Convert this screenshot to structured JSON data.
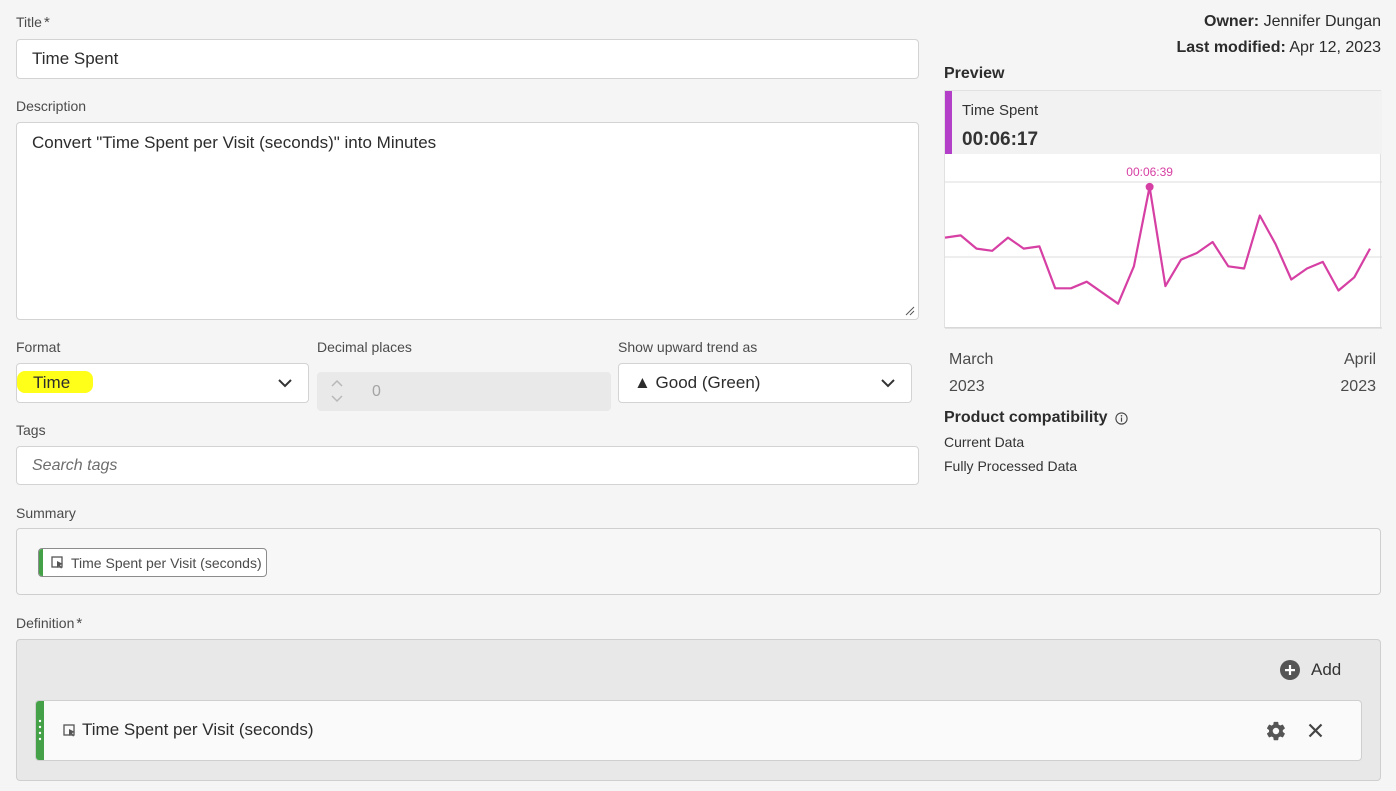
{
  "form": {
    "title_label": "Title",
    "required_mark": "*",
    "title_value": "Time Spent",
    "description_label": "Description",
    "description_value": "Convert \"Time Spent per Visit (seconds)\" into Minutes",
    "format_label": "Format",
    "format_value": "Time",
    "decimal_label": "Decimal places",
    "decimal_value": "0",
    "trend_label": "Show upward trend as",
    "trend_value": "▲ Good (Green)",
    "tags_label": "Tags",
    "tags_placeholder": "Search tags",
    "summary_label": "Summary",
    "summary_chip": "Time Spent per Visit (seconds)",
    "definition_label": "Definition",
    "add_label": "Add",
    "definition_item": "Time Spent per Visit (seconds)"
  },
  "meta": {
    "owner_label": "Owner:",
    "owner_value": "Jennifer Dungan",
    "modified_label": "Last modified:",
    "modified_value": "Apr 12, 2023"
  },
  "preview": {
    "label": "Preview",
    "metric_name": "Time Spent",
    "metric_value": "00:06:17",
    "peak_label": "00:06:39",
    "x_start_month": "March",
    "x_start_year": "2023",
    "x_end_month": "April",
    "x_end_year": "2023",
    "line_color": "#d63fa3",
    "accent_color": "#b33ec7"
  },
  "chart_data": {
    "type": "line",
    "series": [
      {
        "values": [
          0.41,
          0.42,
          0.36,
          0.35,
          0.41,
          0.36,
          0.37,
          0.18,
          0.18,
          0.21,
          0.16,
          0.11,
          0.28,
          0.64,
          0.19,
          0.31,
          0.34,
          0.39,
          0.28,
          0.27,
          0.51,
          0.38,
          0.22,
          0.27,
          0.3,
          0.17,
          0.23,
          0.36
        ]
      }
    ],
    "peak_index": 13,
    "grid": true
  },
  "compat": {
    "title": "Product compatibility",
    "items": [
      "Current Data",
      "Fully Processed Data"
    ]
  },
  "highlight_color": "#ffff1a"
}
